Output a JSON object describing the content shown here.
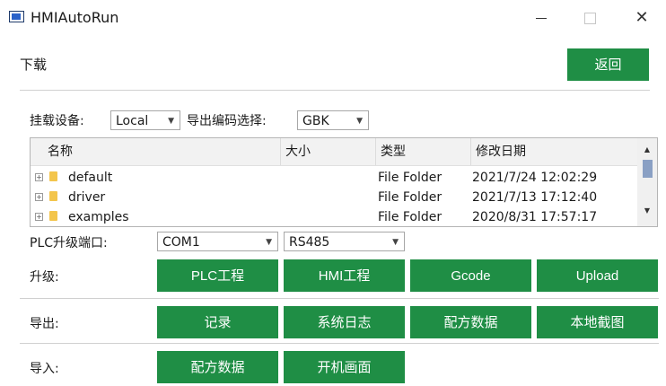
{
  "window": {
    "title": "HMIAutoRun",
    "icon": "app-window-icon",
    "controls": {
      "minimize": "minimize-icon",
      "maximize": "maximize-icon",
      "close": "close-icon"
    }
  },
  "header": {
    "title": "下载",
    "back_label": "返回"
  },
  "device": {
    "label": "挂载设备:",
    "value": "Local",
    "encoding_label": "导出编码选择:",
    "encoding_value": "GBK"
  },
  "file_table": {
    "columns": [
      "名称",
      "大小",
      "类型",
      "修改日期"
    ],
    "rows": [
      {
        "name": "default",
        "size": "",
        "type": "File Folder",
        "modified": "2021/7/24 12:02:29"
      },
      {
        "name": "driver",
        "size": "",
        "type": "File Folder",
        "modified": "2021/7/13 17:12:40"
      },
      {
        "name": "examples",
        "size": "",
        "type": "File Folder",
        "modified": "2020/8/31 17:57:17"
      }
    ]
  },
  "plc_port": {
    "label": "PLC升级端口:",
    "port": "COM1",
    "protocol": "RS485"
  },
  "upgrade": {
    "label": "升级:",
    "buttons": [
      "PLC工程",
      "HMI工程",
      "Gcode",
      "Upload"
    ]
  },
  "export": {
    "label": "导出:",
    "buttons": [
      "记录",
      "系统日志",
      "配方数据",
      "本地截图"
    ]
  },
  "import": {
    "label": "导入:",
    "buttons": [
      "配方数据",
      "开机画面"
    ]
  },
  "colors": {
    "button_green": "#1f8e45",
    "folder_yellow": "#f3c54c",
    "scroll_thumb": "#8aa0c4"
  }
}
